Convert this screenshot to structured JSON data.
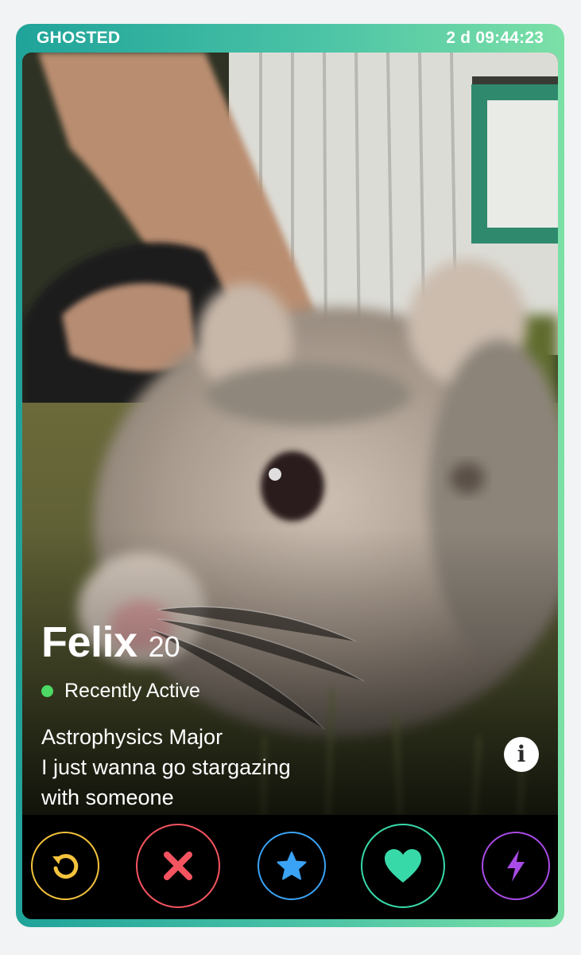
{
  "header": {
    "status_label": "GHOSTED",
    "countdown": "2 d 09:44:23"
  },
  "profile": {
    "name": "Felix",
    "age": "20",
    "activity": "Recently Active",
    "bio_lines": [
      "Astrophysics Major",
      "I just wanna go stargazing",
      "with someone"
    ],
    "photo_description_icon": "hamster-photo"
  },
  "actions": [
    {
      "name": "rewind",
      "icon": "rewind-icon",
      "color": "#f4c33d"
    },
    {
      "name": "nope",
      "icon": "close-icon",
      "color": "#f3545f"
    },
    {
      "name": "super-like",
      "icon": "star-icon",
      "color": "#3aa3f5"
    },
    {
      "name": "like",
      "icon": "heart-icon",
      "color": "#38d9a9"
    },
    {
      "name": "boost",
      "icon": "lightning-icon",
      "color": "#a94be6"
    }
  ],
  "colors": {
    "frame_gradient_start": "#1fa39a",
    "frame_gradient_end": "#7ce0a7",
    "active_dot": "#4cd964"
  }
}
